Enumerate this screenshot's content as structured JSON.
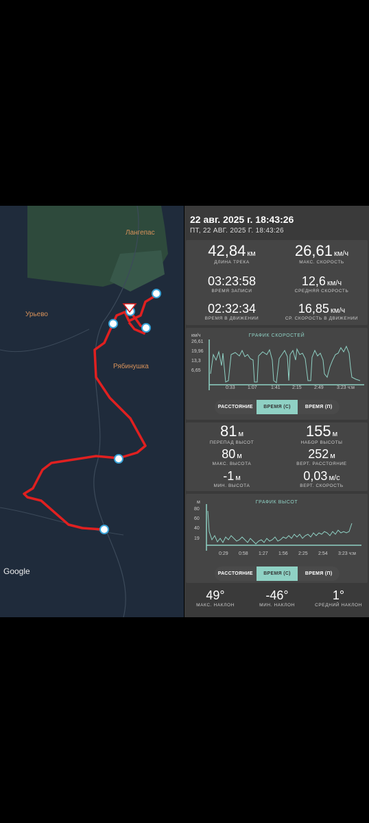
{
  "map": {
    "places": {
      "langepas": "Лангепас",
      "urievo": "Урьево",
      "ryabinushka": "Рябинушка"
    },
    "attribution": "Google",
    "colors": {
      "background": "#1f2b3b",
      "track": "#e02020",
      "green": "#2e4a3c"
    }
  },
  "header": {
    "title": "22 авг. 2025 г. 18:43:26",
    "subtitle": "ПТ, 22 АВГ. 2025 Г. 18:43:26"
  },
  "stats1": {
    "length": {
      "value": "42,84",
      "unit": "км",
      "label": "ДЛИНА ТРЕКА"
    },
    "max_speed": {
      "value": "26,61",
      "unit": "км/ч",
      "label": "МАКС. СКОРОСТЬ"
    },
    "rec_time": {
      "value": "03:23:58",
      "label": "ВРЕМЯ ЗАПИСИ"
    },
    "avg_speed": {
      "value": "12,6",
      "unit": "км/ч",
      "label": "СРЕДНЯЯ СКОРОСТЬ"
    },
    "move_time": {
      "value": "02:32:34",
      "label": "ВРЕМЯ В ДВИЖЕНИИ"
    },
    "avg_move_speed": {
      "value": "16,85",
      "unit": "км/ч",
      "label": "СР. СКОРОСТЬ В ДВИЖЕНИИ"
    }
  },
  "speed_chart": {
    "title": "ГРАФИК СКОРОСТЕЙ",
    "y_unit": "км/ч",
    "y_ticks": [
      "26,61",
      "19,96",
      "13,3",
      "6,65"
    ],
    "x_ticks": [
      "0:33",
      "1:07",
      "1:41",
      "2:15",
      "2:49",
      "3:23 ч:м"
    ]
  },
  "seg1": {
    "distance": "РАССТОЯНИЕ",
    "time_c": "ВРЕМЯ (С)",
    "time_p": "ВРЕМЯ (П)"
  },
  "stats2": {
    "elev_diff": {
      "value": "81",
      "unit": "м",
      "label": "ПЕРЕПАД ВЫСОТ"
    },
    "climb": {
      "value": "155",
      "unit": "м",
      "label": "НАБОР ВЫСОТЫ"
    },
    "max_elev": {
      "value": "80",
      "unit": "м",
      "label": "МАКС. ВЫСОТА"
    },
    "vert_dist": {
      "value": "252",
      "unit": "м",
      "label": "ВЕРТ. РАССТОЯНИЕ"
    },
    "min_elev": {
      "value": "-1",
      "unit": "м",
      "label": "МИН. ВЫСОТА"
    },
    "vert_speed": {
      "value": "0,03",
      "unit": "м/с",
      "label": "ВЕРТ. СКОРОСТЬ"
    }
  },
  "elev_chart": {
    "title": "ГРАФИК ВЫСОТ",
    "y_unit": "м",
    "y_ticks": [
      "80",
      "60",
      "40",
      "19"
    ],
    "x_ticks": [
      "0:29",
      "0:58",
      "1:27",
      "1:56",
      "2:25",
      "2:54",
      "3:23 ч:м"
    ]
  },
  "seg2": {
    "distance": "РАССТОЯНИЕ",
    "time_c": "ВРЕМЯ (С)",
    "time_p": "ВРЕМЯ (П)"
  },
  "slopes": {
    "max": {
      "value": "49°",
      "label": "МАКС. НАКЛОН"
    },
    "min": {
      "value": "-46°",
      "label": "МИН. НАКЛОН"
    },
    "avg": {
      "value": "1°",
      "label": "СРЕДНИЙ НАКЛОН"
    }
  }
}
